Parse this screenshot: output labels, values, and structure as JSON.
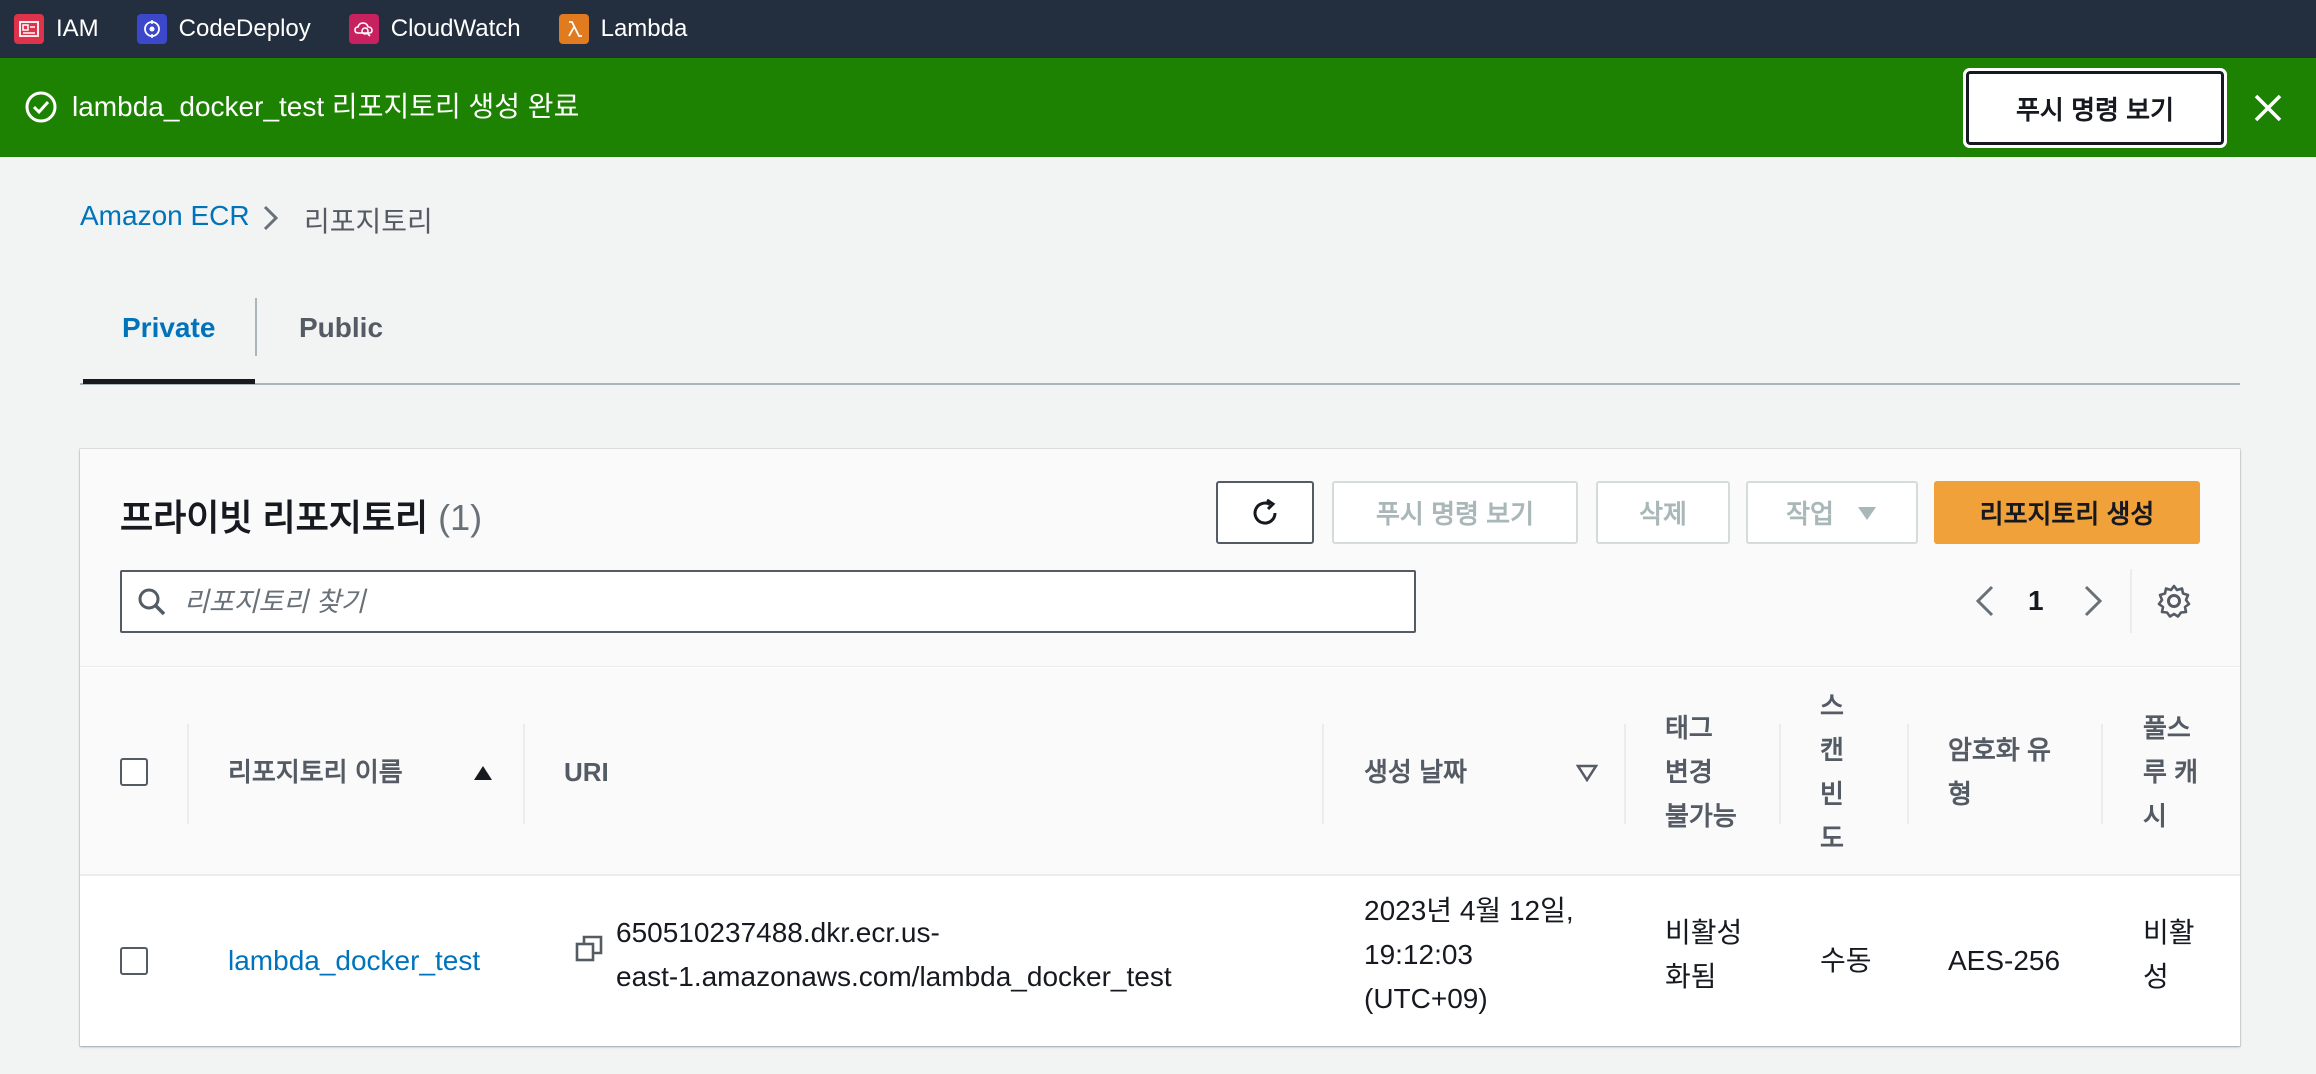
{
  "topbar": {
    "services": [
      {
        "label": "IAM",
        "icon": "iam-icon",
        "color": "#dd344c"
      },
      {
        "label": "CodeDeploy",
        "icon": "codedeploy-icon",
        "color": "#3b48cc"
      },
      {
        "label": "CloudWatch",
        "icon": "cloudwatch-icon",
        "color": "#c7215f"
      },
      {
        "label": "Lambda",
        "icon": "lambda-icon",
        "color": "#e07b1f"
      }
    ]
  },
  "flash": {
    "message": "lambda_docker_test 리포지토리 생성 완료",
    "button_label": "푸시 명령 보기",
    "color": "#1d8102"
  },
  "breadcrumb": {
    "root": "Amazon ECR",
    "current": "리포지토리"
  },
  "tabs": {
    "private": "Private",
    "public": "Public",
    "active": "Private"
  },
  "panel": {
    "title": "프라이빗 리포지토리",
    "count": "(1)",
    "buttons": {
      "push": "푸시 명령 보기",
      "delete": "삭제",
      "actions": "작업",
      "create": "리포지토리 생성"
    },
    "search_placeholder": "리포지토리 찾기",
    "page": "1"
  },
  "table": {
    "columns": {
      "name": "리포지토리 이름",
      "uri": "URI",
      "created": "생성 날짜",
      "tag_immutability": [
        "태그",
        "변경",
        "불가능"
      ],
      "scan_frequency": [
        "스",
        "캔",
        "빈",
        "도"
      ],
      "encryption": [
        "암호화 유",
        "형"
      ],
      "pull_through": [
        "풀스",
        "루 캐",
        "시"
      ]
    },
    "rows": [
      {
        "name": "lambda_docker_test",
        "uri": [
          "650510237488.dkr.ecr.us-",
          "east-1.amazonaws.com/lambda_docker_test"
        ],
        "created": [
          "2023년 4월 12일,",
          "19:12:03",
          "(UTC+09)"
        ],
        "tag_immutability": [
          "비활성",
          "화됨"
        ],
        "scan_frequency": "수동",
        "encryption": "AES-256",
        "pull_through": [
          "비활",
          "성"
        ]
      }
    ]
  }
}
